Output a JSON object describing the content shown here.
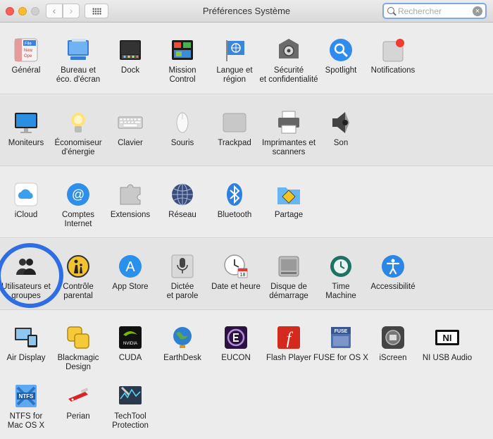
{
  "window": {
    "title": "Préférences Système",
    "back_glyph": "‹",
    "forward_glyph": "›"
  },
  "search": {
    "placeholder": "Rechercher",
    "value": "",
    "clear_glyph": "×"
  },
  "sections": {
    "personal": [
      {
        "label": "Général",
        "icon": "general-icon"
      },
      {
        "label": "Bureau et\néco. d'écran",
        "icon": "desktop-screensaver-icon"
      },
      {
        "label": "Dock",
        "icon": "dock-icon"
      },
      {
        "label": "Mission\nControl",
        "icon": "mission-control-icon"
      },
      {
        "label": "Langue et\nrégion",
        "icon": "language-region-icon"
      },
      {
        "label": "Sécurité\net confidentialité",
        "icon": "security-icon"
      },
      {
        "label": "Spotlight",
        "icon": "spotlight-icon"
      },
      {
        "label": "Notifications",
        "icon": "notifications-icon"
      }
    ],
    "hardware": [
      {
        "label": "Moniteurs",
        "icon": "displays-icon"
      },
      {
        "label": "Économiseur\nd'énergie",
        "icon": "energy-saver-icon"
      },
      {
        "label": "Clavier",
        "icon": "keyboard-icon"
      },
      {
        "label": "Souris",
        "icon": "mouse-icon"
      },
      {
        "label": "Trackpad",
        "icon": "trackpad-icon"
      },
      {
        "label": "Imprimantes et\nscanners",
        "icon": "printer-icon"
      },
      {
        "label": "Son",
        "icon": "sound-icon"
      }
    ],
    "internet": [
      {
        "label": "iCloud",
        "icon": "icloud-icon"
      },
      {
        "label": "Comptes\nInternet",
        "icon": "internet-accounts-icon"
      },
      {
        "label": "Extensions",
        "icon": "extensions-icon"
      },
      {
        "label": "Réseau",
        "icon": "network-icon"
      },
      {
        "label": "Bluetooth",
        "icon": "bluetooth-icon"
      },
      {
        "label": "Partage",
        "icon": "sharing-icon"
      }
    ],
    "system": [
      {
        "label": "Utilisateurs et\ngroupes",
        "icon": "users-groups-icon"
      },
      {
        "label": "Contrôle\nparental",
        "icon": "parental-controls-icon"
      },
      {
        "label": "App Store",
        "icon": "app-store-icon"
      },
      {
        "label": "Dictée\net parole",
        "icon": "dictation-icon"
      },
      {
        "label": "Date et heure",
        "icon": "date-time-icon"
      },
      {
        "label": "Disque de\ndémarrage",
        "icon": "startup-disk-icon"
      },
      {
        "label": "Time\nMachine",
        "icon": "time-machine-icon"
      },
      {
        "label": "Accessibilité",
        "icon": "accessibility-icon"
      }
    ],
    "other": [
      {
        "label": "Air Display",
        "icon": "air-display-icon"
      },
      {
        "label": "Blackmagic\nDesign",
        "icon": "blackmagic-icon"
      },
      {
        "label": "CUDA",
        "icon": "cuda-icon"
      },
      {
        "label": "EarthDesk",
        "icon": "earthdesk-icon"
      },
      {
        "label": "EUCON",
        "icon": "eucon-icon"
      },
      {
        "label": "Flash Player",
        "icon": "flash-player-icon"
      },
      {
        "label": "FUSE for OS X",
        "icon": "fuse-icon"
      },
      {
        "label": "iScreen",
        "icon": "iscreen-icon"
      },
      {
        "label": "NI USB Audio",
        "icon": "ni-usb-audio-icon"
      },
      {
        "label": "NTFS for\nMac OS X",
        "icon": "ntfs-icon"
      },
      {
        "label": "Perian",
        "icon": "perian-icon"
      },
      {
        "label": "TechTool\nProtection",
        "icon": "techtool-icon"
      }
    ]
  },
  "icon_texts": {
    "general_file": "File",
    "general_new": "New",
    "general_open": "Ope",
    "fuse": "FUSE",
    "ntfs": "NTFS",
    "ni": "NI",
    "nvidia": "NVIDIA",
    "calendar_day": "18",
    "dictation": "🎤",
    "flash": "f",
    "appstore": "A",
    "spotlight": "⌕",
    "bluetooth": "ᛒ",
    "internet": "@"
  },
  "colors": {
    "highlight_ring": "#2f6de4",
    "search_focus": "#7fa8e5"
  }
}
